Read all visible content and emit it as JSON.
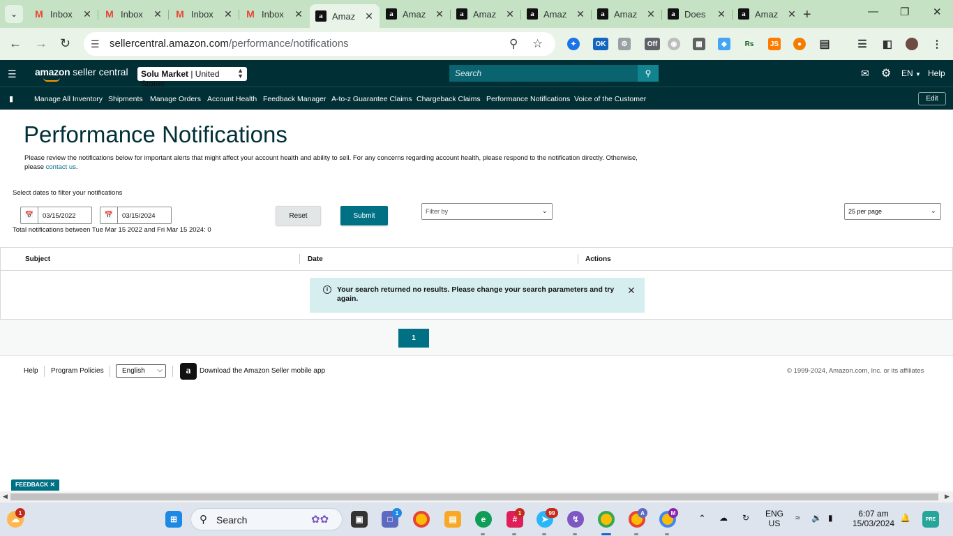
{
  "browser": {
    "tabs": [
      {
        "label": "Inbox",
        "icon": "gmail-icon"
      },
      {
        "label": "Inbox",
        "icon": "gmail-icon"
      },
      {
        "label": "Inbox",
        "icon": "gmail-icon"
      },
      {
        "label": "Inbox",
        "icon": "gmail-icon"
      },
      {
        "label": "Amaz",
        "icon": "amazon-icon",
        "active": true
      },
      {
        "label": "Amaz",
        "icon": "amazon-icon"
      },
      {
        "label": "Amaz",
        "icon": "amazon-icon"
      },
      {
        "label": "Amaz",
        "icon": "amazon-icon"
      },
      {
        "label": "Amaz",
        "icon": "amazon-icon"
      },
      {
        "label": "Does",
        "icon": "amazon-icon"
      },
      {
        "label": "Amaz",
        "icon": "amazon-icon"
      }
    ],
    "url_domain": "sellercentral.amazon.com",
    "url_path": "/performance/notifications",
    "ext_ok_label": "OK",
    "ext_off_label": "Off",
    "ext_js_label": "JS",
    "ext_rs_label": "Rs"
  },
  "header": {
    "logo_text": "amazon",
    "logo_suffix": " seller central",
    "market_name": "Solu Market",
    "market_region": " | United States",
    "search_placeholder": "Search",
    "lang": "EN",
    "help": "Help"
  },
  "nav": {
    "links": [
      "Manage All Inventory",
      "Shipments",
      "Manage Orders",
      "Account Health",
      "Feedback Manager",
      "A-to-z Guarantee Claims",
      "Chargeback Claims",
      "Performance Notifications",
      "Voice of the Customer"
    ],
    "edit": "Edit"
  },
  "page": {
    "title": "Performance Notifications",
    "desc_main": "Please review the notifications below for important alerts that might affect your account health and ability to sell. For any concerns regarding account health, please respond to the notification directly. Otherwise, please ",
    "desc_link": "contact us",
    "desc_end": ".",
    "filter_label": "Select dates to filter your notifications",
    "date_from": "03/15/2022",
    "date_to": "03/15/2024",
    "total_text": "Total notifications between Tue Mar 15 2022 and Fri Mar 15 2024: 0",
    "reset": "Reset",
    "submit": "Submit",
    "filter_by": "Filter by",
    "per_page": "25 per page"
  },
  "table": {
    "columns": [
      "Subject",
      "Date",
      "Actions"
    ],
    "empty_message": "Your search returned no results. Please change your search parameters and try again.",
    "current_page": "1"
  },
  "footer": {
    "help": "Help",
    "policies": "Program Policies",
    "language": "English",
    "app_text": "Download the Amazon Seller mobile app",
    "copyright": "© 1999-2024, Amazon.com, Inc. or its affiliates",
    "feedback": "FEEDBACK"
  },
  "taskbar": {
    "search": "Search",
    "lang_top": "ENG",
    "lang_bottom": "US",
    "time": "6:07 am",
    "date": "15/03/2024",
    "badges": {
      "weather": "1",
      "teams": "1",
      "slack": "1",
      "telegram": "99",
      "chrome_a": "A",
      "chrome_m": "M"
    },
    "pre_label": "PRE"
  },
  "colors": {
    "header_bg": "#002f36",
    "accent": "#007185",
    "tab_strip": "#c5e3c4"
  }
}
